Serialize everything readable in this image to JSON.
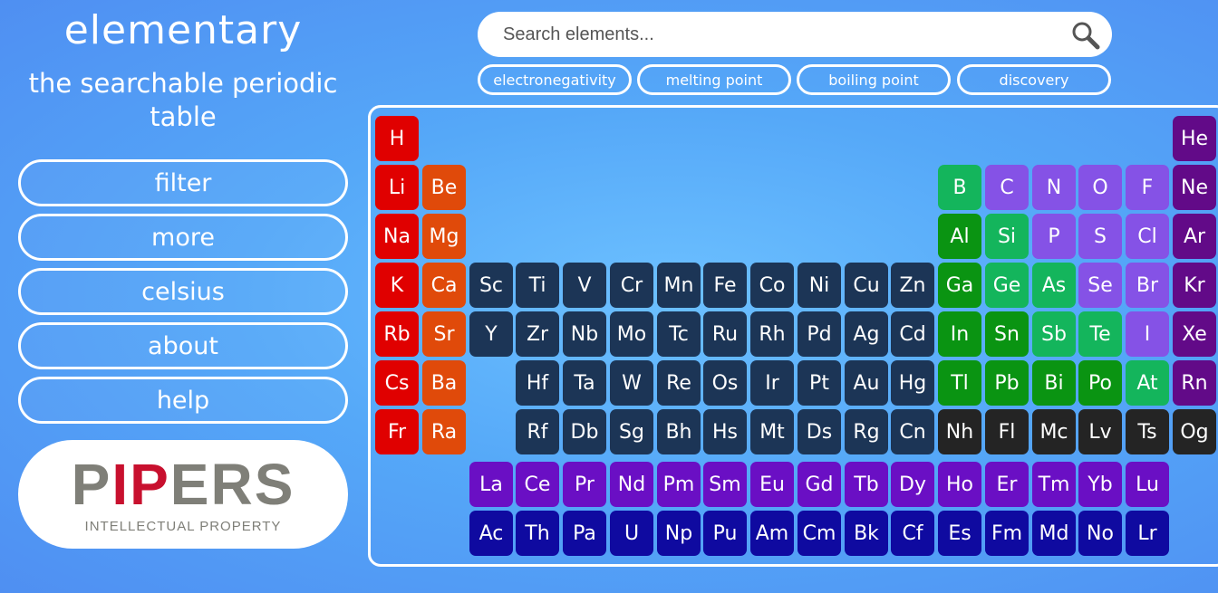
{
  "sidebar": {
    "title": "elementary",
    "subtitle_line1": "the searchable periodic",
    "subtitle_line2": "table",
    "buttons": [
      "filter",
      "more",
      "celsius",
      "about",
      "help"
    ],
    "logo": {
      "word": "PIPERS",
      "tagline": "INTELLECTUAL PROPERTY"
    }
  },
  "search": {
    "placeholder": "Search elements...",
    "value": ""
  },
  "sort_buttons": [
    "electronegativity",
    "melting point",
    "boiling point",
    "discovery"
  ],
  "colors": {
    "alkali": "#e00000",
    "alkaline": "#e04a0a",
    "transition": "#1c3556",
    "post_transition": "#0a9412",
    "metalloid": "#14b55c",
    "nonmetal": "#8552e6",
    "noble": "#620a88",
    "unknown": "#242424",
    "lanthanide": "#6a0fc4",
    "actinide": "#0f0aa0"
  },
  "elements": [
    {
      "symbol": "H",
      "row": 1,
      "col": 1,
      "group": "alkali"
    },
    {
      "symbol": "He",
      "row": 1,
      "col": 18,
      "group": "noble"
    },
    {
      "symbol": "Li",
      "row": 2,
      "col": 1,
      "group": "alkali"
    },
    {
      "symbol": "Be",
      "row": 2,
      "col": 2,
      "group": "alkaline"
    },
    {
      "symbol": "B",
      "row": 2,
      "col": 13,
      "group": "metalloid"
    },
    {
      "symbol": "C",
      "row": 2,
      "col": 14,
      "group": "nonmetal"
    },
    {
      "symbol": "N",
      "row": 2,
      "col": 15,
      "group": "nonmetal"
    },
    {
      "symbol": "O",
      "row": 2,
      "col": 16,
      "group": "nonmetal"
    },
    {
      "symbol": "F",
      "row": 2,
      "col": 17,
      "group": "nonmetal"
    },
    {
      "symbol": "Ne",
      "row": 2,
      "col": 18,
      "group": "noble"
    },
    {
      "symbol": "Na",
      "row": 3,
      "col": 1,
      "group": "alkali"
    },
    {
      "symbol": "Mg",
      "row": 3,
      "col": 2,
      "group": "alkaline"
    },
    {
      "symbol": "Al",
      "row": 3,
      "col": 13,
      "group": "post_transition"
    },
    {
      "symbol": "Si",
      "row": 3,
      "col": 14,
      "group": "metalloid"
    },
    {
      "symbol": "P",
      "row": 3,
      "col": 15,
      "group": "nonmetal"
    },
    {
      "symbol": "S",
      "row": 3,
      "col": 16,
      "group": "nonmetal"
    },
    {
      "symbol": "Cl",
      "row": 3,
      "col": 17,
      "group": "nonmetal"
    },
    {
      "symbol": "Ar",
      "row": 3,
      "col": 18,
      "group": "noble"
    },
    {
      "symbol": "K",
      "row": 4,
      "col": 1,
      "group": "alkali"
    },
    {
      "symbol": "Ca",
      "row": 4,
      "col": 2,
      "group": "alkaline"
    },
    {
      "symbol": "Sc",
      "row": 4,
      "col": 3,
      "group": "transition"
    },
    {
      "symbol": "Ti",
      "row": 4,
      "col": 4,
      "group": "transition"
    },
    {
      "symbol": "V",
      "row": 4,
      "col": 5,
      "group": "transition"
    },
    {
      "symbol": "Cr",
      "row": 4,
      "col": 6,
      "group": "transition"
    },
    {
      "symbol": "Mn",
      "row": 4,
      "col": 7,
      "group": "transition"
    },
    {
      "symbol": "Fe",
      "row": 4,
      "col": 8,
      "group": "transition"
    },
    {
      "symbol": "Co",
      "row": 4,
      "col": 9,
      "group": "transition"
    },
    {
      "symbol": "Ni",
      "row": 4,
      "col": 10,
      "group": "transition"
    },
    {
      "symbol": "Cu",
      "row": 4,
      "col": 11,
      "group": "transition"
    },
    {
      "symbol": "Zn",
      "row": 4,
      "col": 12,
      "group": "transition"
    },
    {
      "symbol": "Ga",
      "row": 4,
      "col": 13,
      "group": "post_transition"
    },
    {
      "symbol": "Ge",
      "row": 4,
      "col": 14,
      "group": "metalloid"
    },
    {
      "symbol": "As",
      "row": 4,
      "col": 15,
      "group": "metalloid"
    },
    {
      "symbol": "Se",
      "row": 4,
      "col": 16,
      "group": "nonmetal"
    },
    {
      "symbol": "Br",
      "row": 4,
      "col": 17,
      "group": "nonmetal"
    },
    {
      "symbol": "Kr",
      "row": 4,
      "col": 18,
      "group": "noble"
    },
    {
      "symbol": "Rb",
      "row": 5,
      "col": 1,
      "group": "alkali"
    },
    {
      "symbol": "Sr",
      "row": 5,
      "col": 2,
      "group": "alkaline"
    },
    {
      "symbol": "Y",
      "row": 5,
      "col": 3,
      "group": "transition"
    },
    {
      "symbol": "Zr",
      "row": 5,
      "col": 4,
      "group": "transition"
    },
    {
      "symbol": "Nb",
      "row": 5,
      "col": 5,
      "group": "transition"
    },
    {
      "symbol": "Mo",
      "row": 5,
      "col": 6,
      "group": "transition"
    },
    {
      "symbol": "Tc",
      "row": 5,
      "col": 7,
      "group": "transition"
    },
    {
      "symbol": "Ru",
      "row": 5,
      "col": 8,
      "group": "transition"
    },
    {
      "symbol": "Rh",
      "row": 5,
      "col": 9,
      "group": "transition"
    },
    {
      "symbol": "Pd",
      "row": 5,
      "col": 10,
      "group": "transition"
    },
    {
      "symbol": "Ag",
      "row": 5,
      "col": 11,
      "group": "transition"
    },
    {
      "symbol": "Cd",
      "row": 5,
      "col": 12,
      "group": "transition"
    },
    {
      "symbol": "In",
      "row": 5,
      "col": 13,
      "group": "post_transition"
    },
    {
      "symbol": "Sn",
      "row": 5,
      "col": 14,
      "group": "post_transition"
    },
    {
      "symbol": "Sb",
      "row": 5,
      "col": 15,
      "group": "metalloid"
    },
    {
      "symbol": "Te",
      "row": 5,
      "col": 16,
      "group": "metalloid"
    },
    {
      "symbol": "I",
      "row": 5,
      "col": 17,
      "group": "nonmetal"
    },
    {
      "symbol": "Xe",
      "row": 5,
      "col": 18,
      "group": "noble"
    },
    {
      "symbol": "Cs",
      "row": 6,
      "col": 1,
      "group": "alkali"
    },
    {
      "symbol": "Ba",
      "row": 6,
      "col": 2,
      "group": "alkaline"
    },
    {
      "symbol": "Hf",
      "row": 6,
      "col": 4,
      "group": "transition"
    },
    {
      "symbol": "Ta",
      "row": 6,
      "col": 5,
      "group": "transition"
    },
    {
      "symbol": "W",
      "row": 6,
      "col": 6,
      "group": "transition"
    },
    {
      "symbol": "Re",
      "row": 6,
      "col": 7,
      "group": "transition"
    },
    {
      "symbol": "Os",
      "row": 6,
      "col": 8,
      "group": "transition"
    },
    {
      "symbol": "Ir",
      "row": 6,
      "col": 9,
      "group": "transition"
    },
    {
      "symbol": "Pt",
      "row": 6,
      "col": 10,
      "group": "transition"
    },
    {
      "symbol": "Au",
      "row": 6,
      "col": 11,
      "group": "transition"
    },
    {
      "symbol": "Hg",
      "row": 6,
      "col": 12,
      "group": "transition"
    },
    {
      "symbol": "Tl",
      "row": 6,
      "col": 13,
      "group": "post_transition"
    },
    {
      "symbol": "Pb",
      "row": 6,
      "col": 14,
      "group": "post_transition"
    },
    {
      "symbol": "Bi",
      "row": 6,
      "col": 15,
      "group": "post_transition"
    },
    {
      "symbol": "Po",
      "row": 6,
      "col": 16,
      "group": "post_transition"
    },
    {
      "symbol": "At",
      "row": 6,
      "col": 17,
      "group": "metalloid"
    },
    {
      "symbol": "Rn",
      "row": 6,
      "col": 18,
      "group": "noble"
    },
    {
      "symbol": "Fr",
      "row": 7,
      "col": 1,
      "group": "alkali"
    },
    {
      "symbol": "Ra",
      "row": 7,
      "col": 2,
      "group": "alkaline"
    },
    {
      "symbol": "Rf",
      "row": 7,
      "col": 4,
      "group": "transition"
    },
    {
      "symbol": "Db",
      "row": 7,
      "col": 5,
      "group": "transition"
    },
    {
      "symbol": "Sg",
      "row": 7,
      "col": 6,
      "group": "transition"
    },
    {
      "symbol": "Bh",
      "row": 7,
      "col": 7,
      "group": "transition"
    },
    {
      "symbol": "Hs",
      "row": 7,
      "col": 8,
      "group": "transition"
    },
    {
      "symbol": "Mt",
      "row": 7,
      "col": 9,
      "group": "transition"
    },
    {
      "symbol": "Ds",
      "row": 7,
      "col": 10,
      "group": "transition"
    },
    {
      "symbol": "Rg",
      "row": 7,
      "col": 11,
      "group": "transition"
    },
    {
      "symbol": "Cn",
      "row": 7,
      "col": 12,
      "group": "transition"
    },
    {
      "symbol": "Nh",
      "row": 7,
      "col": 13,
      "group": "unknown"
    },
    {
      "symbol": "Fl",
      "row": 7,
      "col": 14,
      "group": "unknown"
    },
    {
      "symbol": "Mc",
      "row": 7,
      "col": 15,
      "group": "unknown"
    },
    {
      "symbol": "Lv",
      "row": 7,
      "col": 16,
      "group": "unknown"
    },
    {
      "symbol": "Ts",
      "row": 7,
      "col": 17,
      "group": "unknown"
    },
    {
      "symbol": "Og",
      "row": 7,
      "col": 18,
      "group": "unknown"
    },
    {
      "symbol": "La",
      "row": 8,
      "col": 3,
      "group": "lanthanide"
    },
    {
      "symbol": "Ce",
      "row": 8,
      "col": 4,
      "group": "lanthanide"
    },
    {
      "symbol": "Pr",
      "row": 8,
      "col": 5,
      "group": "lanthanide"
    },
    {
      "symbol": "Nd",
      "row": 8,
      "col": 6,
      "group": "lanthanide"
    },
    {
      "symbol": "Pm",
      "row": 8,
      "col": 7,
      "group": "lanthanide"
    },
    {
      "symbol": "Sm",
      "row": 8,
      "col": 8,
      "group": "lanthanide"
    },
    {
      "symbol": "Eu",
      "row": 8,
      "col": 9,
      "group": "lanthanide"
    },
    {
      "symbol": "Gd",
      "row": 8,
      "col": 10,
      "group": "lanthanide"
    },
    {
      "symbol": "Tb",
      "row": 8,
      "col": 11,
      "group": "lanthanide"
    },
    {
      "symbol": "Dy",
      "row": 8,
      "col": 12,
      "group": "lanthanide"
    },
    {
      "symbol": "Ho",
      "row": 8,
      "col": 13,
      "group": "lanthanide"
    },
    {
      "symbol": "Er",
      "row": 8,
      "col": 14,
      "group": "lanthanide"
    },
    {
      "symbol": "Tm",
      "row": 8,
      "col": 15,
      "group": "lanthanide"
    },
    {
      "symbol": "Yb",
      "row": 8,
      "col": 16,
      "group": "lanthanide"
    },
    {
      "symbol": "Lu",
      "row": 8,
      "col": 17,
      "group": "lanthanide"
    },
    {
      "symbol": "Ac",
      "row": 9,
      "col": 3,
      "group": "actinide"
    },
    {
      "symbol": "Th",
      "row": 9,
      "col": 4,
      "group": "actinide"
    },
    {
      "symbol": "Pa",
      "row": 9,
      "col": 5,
      "group": "actinide"
    },
    {
      "symbol": "U",
      "row": 9,
      "col": 6,
      "group": "actinide"
    },
    {
      "symbol": "Np",
      "row": 9,
      "col": 7,
      "group": "actinide"
    },
    {
      "symbol": "Pu",
      "row": 9,
      "col": 8,
      "group": "actinide"
    },
    {
      "symbol": "Am",
      "row": 9,
      "col": 9,
      "group": "actinide"
    },
    {
      "symbol": "Cm",
      "row": 9,
      "col": 10,
      "group": "actinide"
    },
    {
      "symbol": "Bk",
      "row": 9,
      "col": 11,
      "group": "actinide"
    },
    {
      "symbol": "Cf",
      "row": 9,
      "col": 12,
      "group": "actinide"
    },
    {
      "symbol": "Es",
      "row": 9,
      "col": 13,
      "group": "actinide"
    },
    {
      "symbol": "Fm",
      "row": 9,
      "col": 14,
      "group": "actinide"
    },
    {
      "symbol": "Md",
      "row": 9,
      "col": 15,
      "group": "actinide"
    },
    {
      "symbol": "No",
      "row": 9,
      "col": 16,
      "group": "actinide"
    },
    {
      "symbol": "Lr",
      "row": 9,
      "col": 17,
      "group": "actinide"
    }
  ]
}
